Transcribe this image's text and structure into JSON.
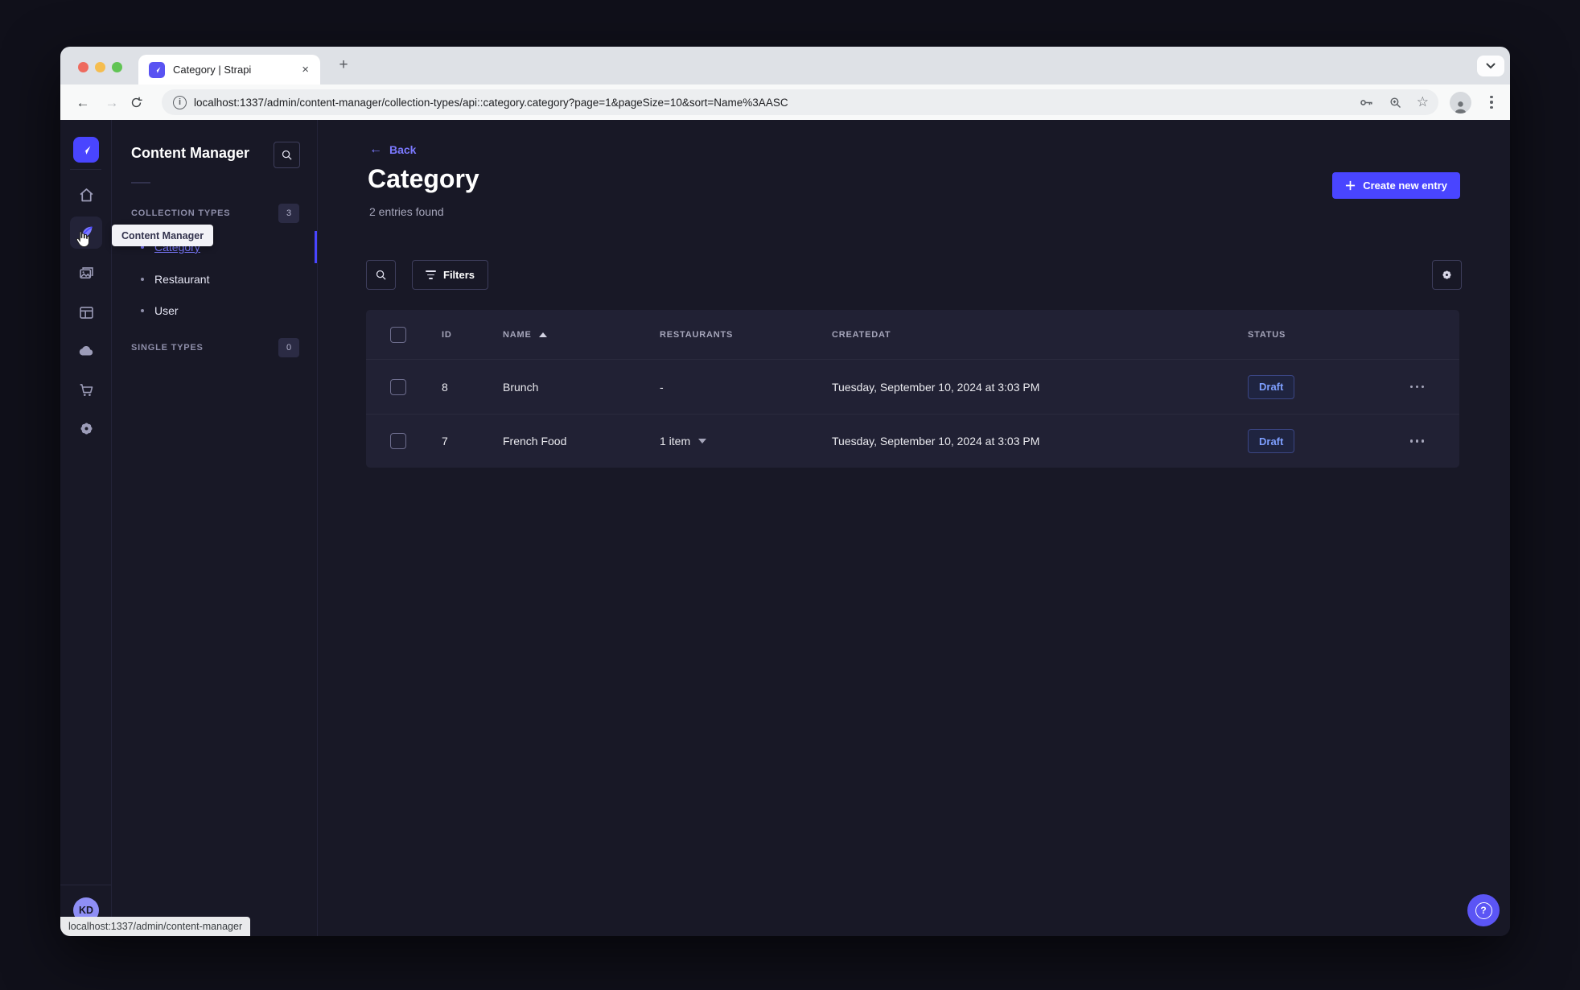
{
  "browser": {
    "tab_title": "Category | Strapi",
    "url": "localhost:1337/admin/content-manager/collection-types/api::category.category?page=1&pageSize=10&sort=Name%3AASC",
    "status_bar": "localhost:1337/admin/content-manager"
  },
  "icons": {
    "close": "×",
    "plus": "+",
    "back_arrow": "←",
    "forward_arrow": "→",
    "star": "☆",
    "info": "i",
    "question": "?"
  },
  "sidebar": {
    "tooltip": "Content Manager",
    "user_initials": "KD"
  },
  "panel": {
    "title": "Content Manager",
    "collection_types": {
      "label": "COLLECTION TYPES",
      "badge": "3",
      "items": [
        {
          "label": "Category"
        },
        {
          "label": "Restaurant"
        },
        {
          "label": "User"
        }
      ]
    },
    "single_types": {
      "label": "SINGLE TYPES",
      "badge": "0"
    }
  },
  "main": {
    "back_label": "Back",
    "title": "Category",
    "subtitle": "2 entries found",
    "create_button": "Create new entry",
    "filters_button": "Filters",
    "table": {
      "headers": {
        "id": "ID",
        "name": "NAME",
        "restaurants": "RESTAURANTS",
        "createdAt": "CREATEDAT",
        "status": "STATUS"
      },
      "rows": [
        {
          "id": "8",
          "name": "Brunch",
          "restaurants": "-",
          "createdAt": "Tuesday, September 10, 2024 at 3:03 PM",
          "status": "Draft"
        },
        {
          "id": "7",
          "name": "French Food",
          "restaurants": "1 item",
          "createdAt": "Tuesday, September 10, 2024 at 3:03 PM",
          "status": "Draft"
        }
      ]
    }
  },
  "colors": {
    "accent": "#4945ff",
    "accent_light": "#7b79ff",
    "app_background": "#181826",
    "surface": "#212134",
    "draft_text": "#7e9fff"
  }
}
